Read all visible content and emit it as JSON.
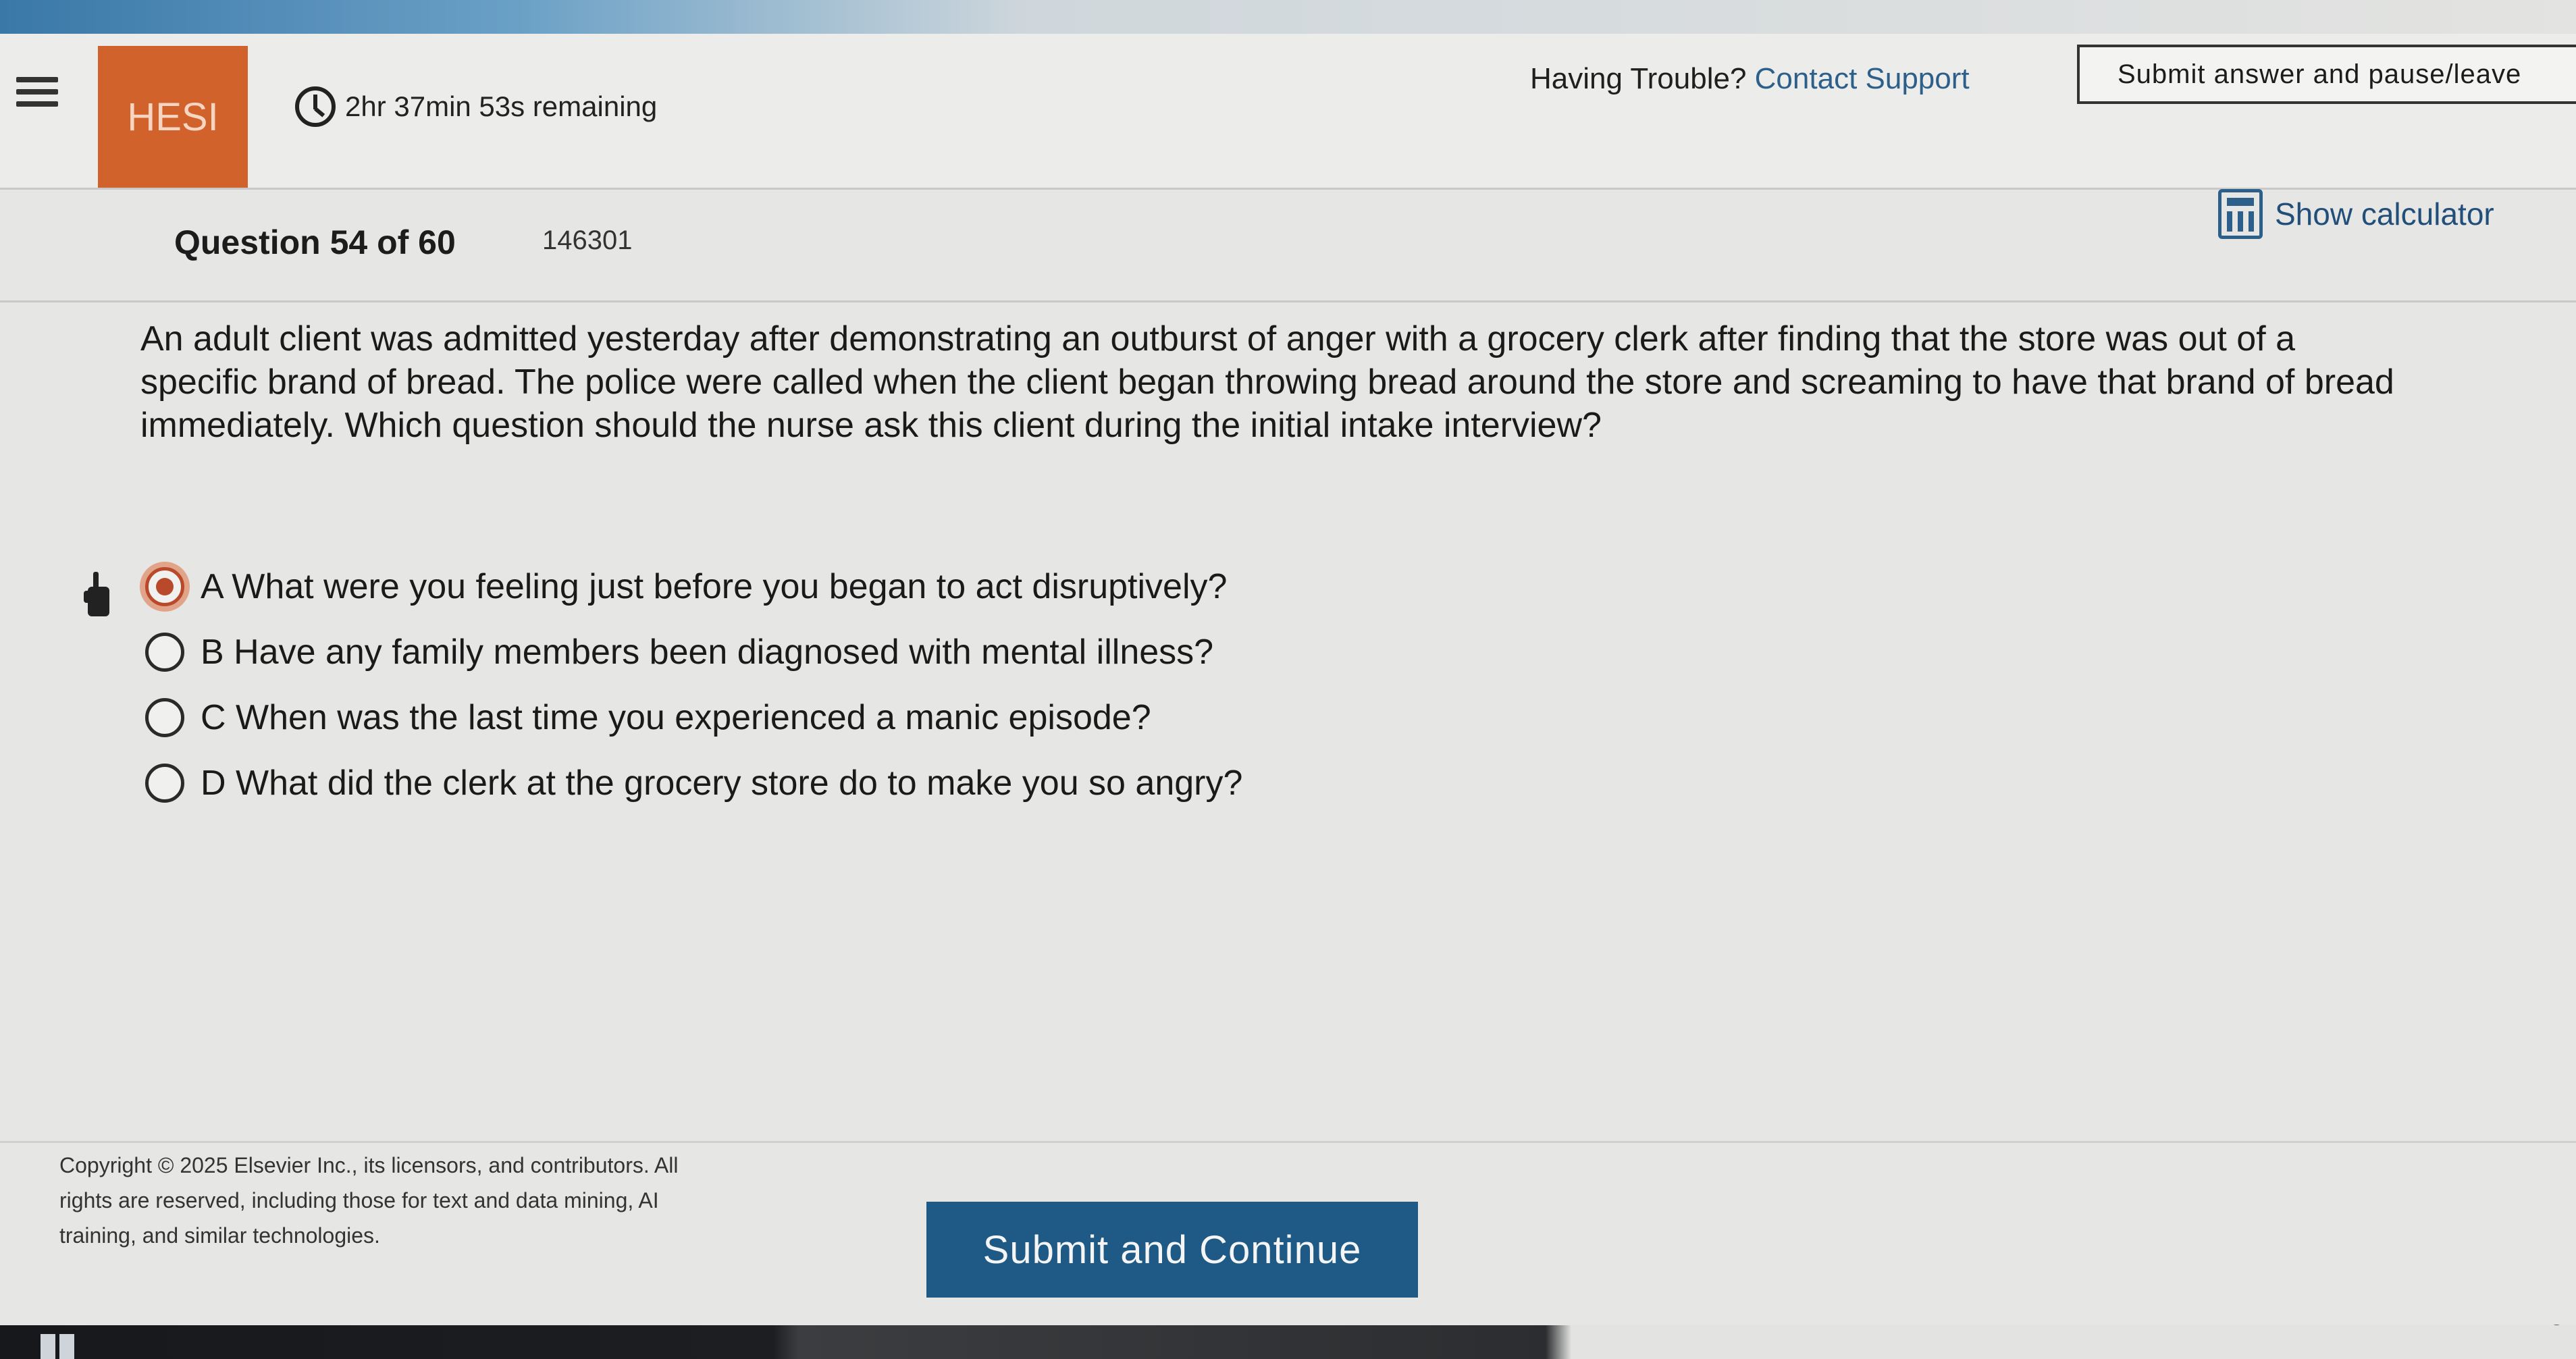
{
  "header": {
    "brand": "HESI",
    "timer": "2hr 37min 53s remaining",
    "help_prefix": "Having Trouble?",
    "help_link": "Contact Support",
    "pause_button": "Submit answer and pause/leave"
  },
  "question": {
    "label": "Question 54 of 60",
    "id": "146301",
    "calculator": "Show calculator",
    "stem": "An adult client was admitted yesterday after demonstrating an outburst of anger with a grocery clerk after finding that the store was out of a specific brand of bread. The police were called when the client began throwing bread around the store and screaming to have that brand of bread immediately. Which question should the nurse ask this client during the initial intake interview?",
    "choices": [
      {
        "text": "A What were you feeling just before you began to act disruptively?",
        "selected": true
      },
      {
        "text": "B Have any family members been diagnosed with mental illness?",
        "selected": false
      },
      {
        "text": "C When was the last time you experienced a manic episode?",
        "selected": false
      },
      {
        "text": "D What did the clerk at the grocery store do to make you so angry?",
        "selected": false
      }
    ]
  },
  "footer": {
    "copyright": "Copyright © 2025 Elsevier Inc., its licensors, and contributors. All rights are reserved, including those for text and data mining, AI training, and similar technologies.",
    "submit_button": "Submit and Continue",
    "version": "v2"
  },
  "colors": {
    "brand": "#d2622b",
    "primary": "#1f5a86",
    "link": "#2d5f8b",
    "selected_radio": "#b8492b"
  }
}
